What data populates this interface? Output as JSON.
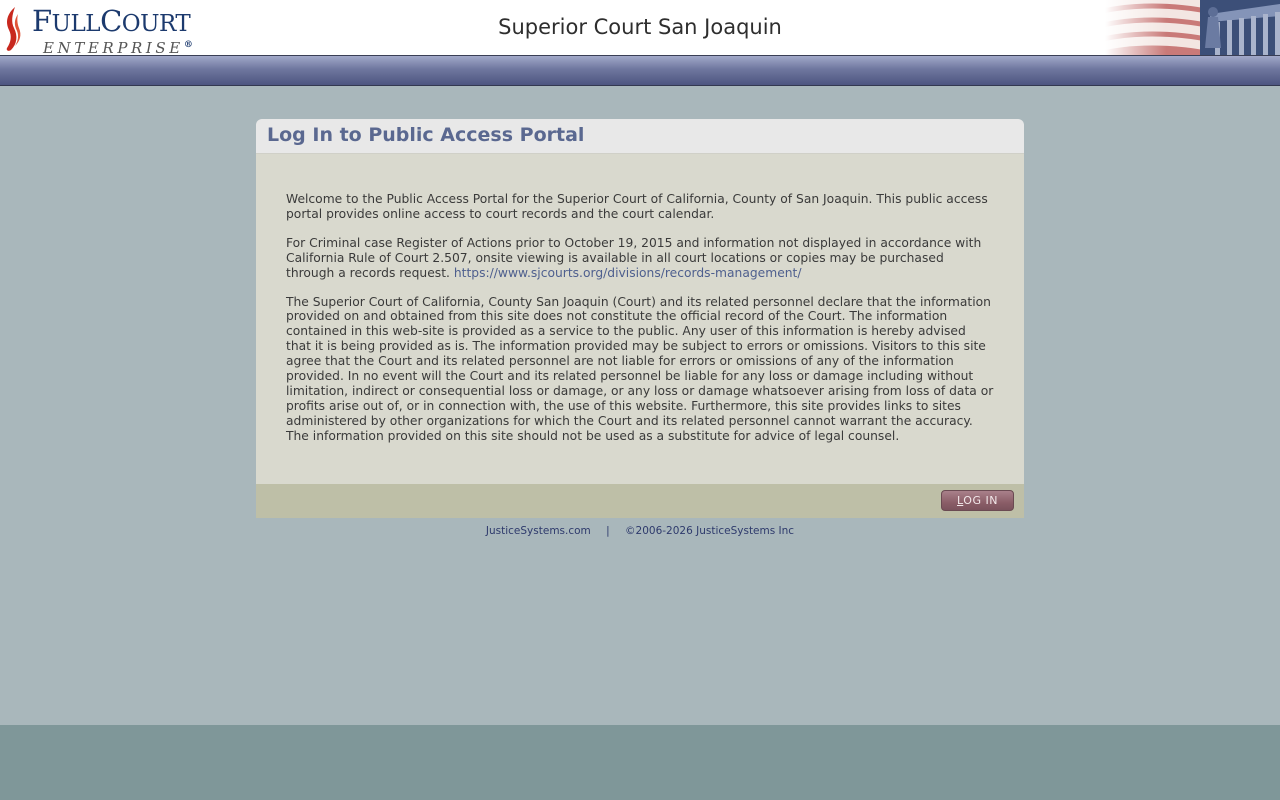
{
  "header": {
    "logo": {
      "full_cap": "F",
      "full_rest": "ULL",
      "court_cap": "C",
      "court_rest": "OURT",
      "enterprise": "ENTERPRISE",
      "registered": "®",
      "brand_color": "#1c3a6e",
      "flame_color": "#c8281e"
    },
    "court_name": "Superior Court San Joaquin"
  },
  "panel": {
    "title": "Log In to Public Access Portal",
    "paragraphs": {
      "welcome": "Welcome to the Public Access Portal for the Superior Court of California, County of San Joaquin. This public access portal provides online access to court records and the court calendar.",
      "criminal": "For Criminal case Register of Actions prior to October 19, 2015 and information not displayed in accordance with California Rule of Court 2.507, onsite viewing is available in all court locations or copies may be purchased through a records request.",
      "records_link": "https://www.sjcourts.org/divisions/records-management/",
      "disclaimer": "The Superior Court of California, County San Joaquin (Court) and its related personnel declare that the information provided on and obtained from this site does not constitute the official record of the Court. The information contained in this web-site is provided as a service to the public. Any user of this information is hereby advised that it is being provided as is. The information provided may be subject to errors or omissions. Visitors to this site agree that the Court and its related personnel are not liable for errors or omissions of any of the information provided. In no event will the Court and its related personnel be liable for any loss or damage including without limitation, indirect or consequential loss or damage, or any loss or damage whatsoever arising from loss of data or profits arise out of, or in connection with, the use of this website. Furthermore, this site provides links to sites administered by other organizations for which the Court and its related personnel cannot warrant the accuracy. The information provided on this site should not be used as a substitute for advice of legal counsel."
    },
    "login_button": {
      "first": "L",
      "rest": "OG IN"
    }
  },
  "footer": {
    "site_link": "JusticeSystems.com",
    "separator": "|",
    "copyright": "©2006-2026 JusticeSystems Inc"
  },
  "colors": {
    "nav_bar": "#6f779f",
    "content_bg": "#a9b7bb",
    "page_bottom": "#7f9799",
    "panel_body": "#d9d9ce",
    "panel_footer": "#bebfa7",
    "title_text": "#5a6890",
    "login_button": "#8b5e68"
  }
}
